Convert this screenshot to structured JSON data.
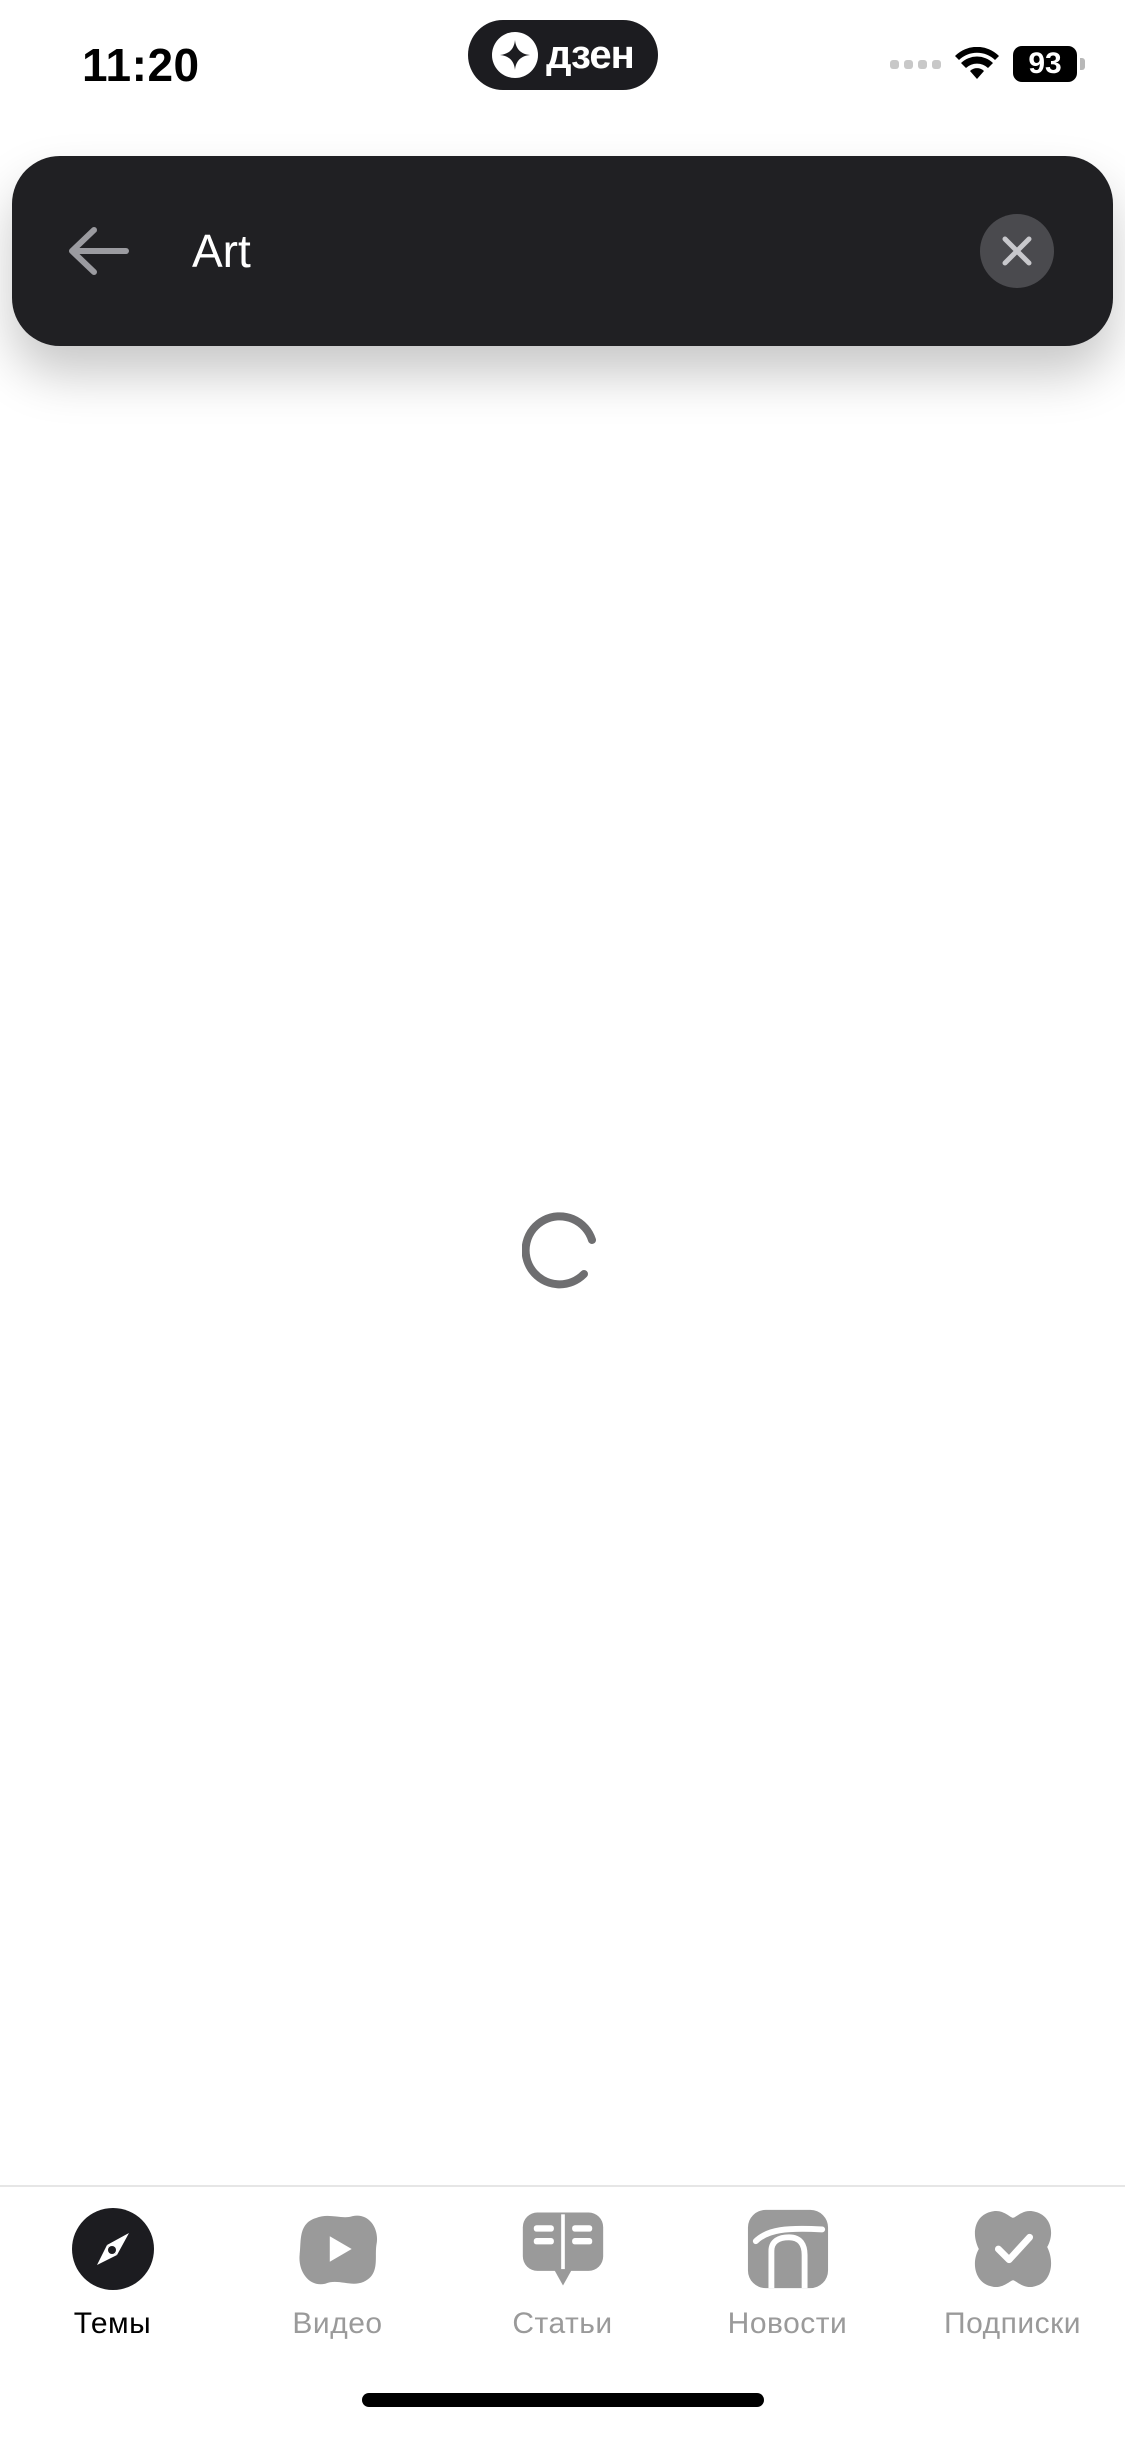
{
  "status_bar": {
    "time": "11:20",
    "app_badge": "дзен",
    "battery": "93"
  },
  "search": {
    "query": "Art"
  },
  "tabs": [
    {
      "label": "Темы",
      "icon": "compass-icon",
      "active": true
    },
    {
      "label": "Видео",
      "icon": "play-icon",
      "active": false
    },
    {
      "label": "Статьи",
      "icon": "articles-icon",
      "active": false
    },
    {
      "label": "Новости",
      "icon": "news-icon",
      "active": false
    },
    {
      "label": "Подписки",
      "icon": "subscriptions-icon",
      "active": false
    }
  ],
  "colors": {
    "search_bar_bg": "#202023",
    "active_tab": "#1c1c20",
    "inactive_tab": "#9a9a9a"
  }
}
